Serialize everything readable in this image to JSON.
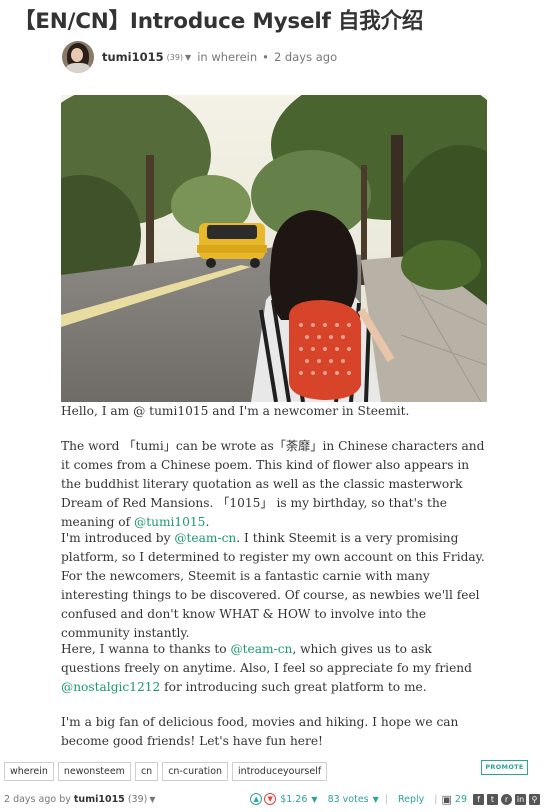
{
  "title": "【EN/CN】Introduce Myself 自我介绍",
  "byline": {
    "author": "tumi1015",
    "reputation": "(39)",
    "in_label": "in",
    "category": "wherein",
    "time": "2 days ago"
  },
  "photo": {
    "alt": "girl with backpack walking on tree-lined road"
  },
  "paragraphs": {
    "p1": "Hello, I am @ tumi1015 and I'm a newcomer in Steemit.",
    "p2_a": "The word 「tumi」can be wrote as「荼靡」in Chinese characters and it comes from a Chinese poem. This kind of flower also appears in the buddhist literary quotation as well as the classic masterwork Dream of Red Mansions. 「1015」 is my birthday, so that's the meaning of ",
    "p2_link": "@tumi1015",
    "p2_b": ".",
    "p3_a": "I'm introduced by ",
    "p3_link": "@team-cn",
    "p3_b": ". I think Steemit is a very promising platform, so I determined to register my own account on this Friday. For the newcomers, Steemit is a fantastic carnie with many interesting things to be discovered. Of course, as newbies we'll feel confused and don't know WHAT & HOW to involve into the community instantly.",
    "p4_a": "Here, I wanna to thanks to ",
    "p4_link1": "@team-cn",
    "p4_b": ", which gives us to ask questions freely on anytime. Also, I feel so appreciate fo my friend ",
    "p4_link2": "@nostalgic1212",
    "p4_c": " for introducing such great platform to me.",
    "p5": "I'm a big fan of delicious food, movies and hiking. I hope we can become good friends! Let's have fun here!"
  },
  "tags": [
    "wherein",
    "newonsteem",
    "cn",
    "cn-curation",
    "introduceyourself"
  ],
  "promote_label": "PROMOTE",
  "footer": {
    "time": "2 days ago",
    "by": "by",
    "author": "tumi1015",
    "reputation": "(39)",
    "payout": "$1.26",
    "votes": "83 votes",
    "reply": "Reply",
    "resteems": "29"
  },
  "colors": {
    "link": "#1a9a6b",
    "accent": "#2ea39a",
    "text": "#333333"
  }
}
